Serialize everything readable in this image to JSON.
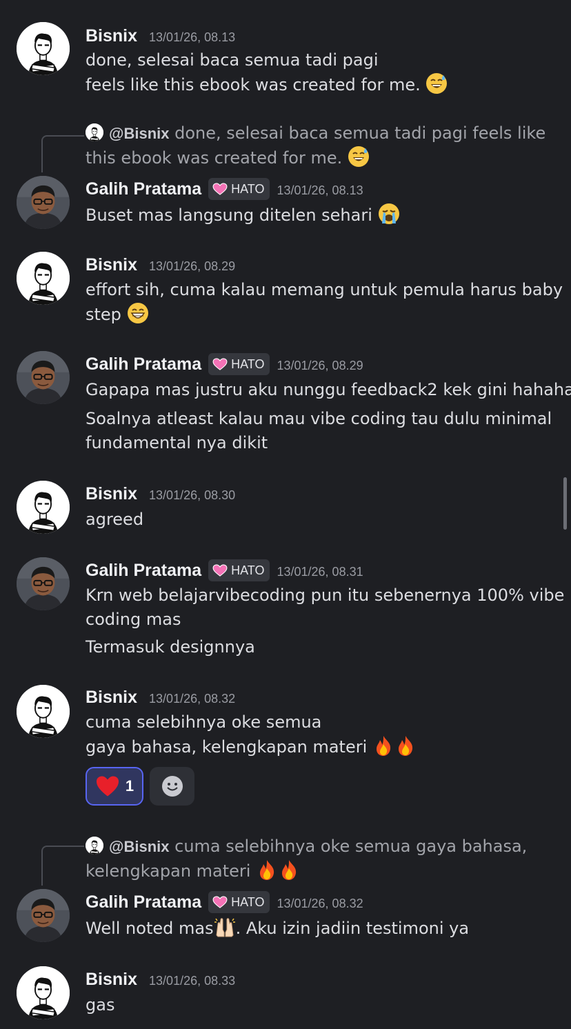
{
  "messages": [
    {
      "author": "Bisnix",
      "time": "13/01/26, 08.13",
      "lines": [
        "done, selesai baca semua tadi pagi",
        "feels like this ebook was created for me."
      ]
    },
    {
      "author": "Galih Pratama",
      "tag": "HATO",
      "time": "13/01/26, 08.13",
      "reply": {
        "mention": "@Bisnix",
        "lines": [
          "done, selesai baca semua tadi pagi feels like",
          "this ebook was created for me."
        ]
      },
      "lines": [
        "Buset mas langsung ditelen sehari"
      ]
    },
    {
      "author": "Bisnix",
      "time": "13/01/26, 08.29",
      "lines": [
        "effort sih, cuma kalau memang untuk pemula harus baby",
        "step"
      ]
    },
    {
      "author": "Galih Pratama",
      "tag": "HATO",
      "time": "13/01/26, 08.29",
      "lines": [
        "Gapapa mas justru aku nunggu feedback2 kek gini hahaha",
        "Soalnya atleast kalau mau vibe coding tau dulu minimal",
        "fundamental nya dikit"
      ]
    },
    {
      "author": "Bisnix",
      "time": "13/01/26, 08.30",
      "lines": [
        "agreed"
      ]
    },
    {
      "author": "Galih Pratama",
      "tag": "HATO",
      "time": "13/01/26, 08.31",
      "lines": [
        "Krn web belajarvibecoding pun itu sebenernya 100% vibe",
        "coding mas",
        "Termasuk designnya"
      ]
    },
    {
      "author": "Bisnix",
      "time": "13/01/26, 08.32",
      "lines": [
        "cuma selebihnya oke semua",
        "gaya bahasa, kelengkapan materi"
      ],
      "reactions": [
        {
          "emoji": "red-heart",
          "count": "1"
        }
      ]
    },
    {
      "author": "Galih Pratama",
      "tag": "HATO",
      "time": "13/01/26, 08.32",
      "reply": {
        "mention": "@Bisnix",
        "lines": [
          "cuma selebihnya oke semua gaya bahasa,",
          "kelengkapan materi"
        ]
      },
      "lines": [
        "Well noted mas",
        ". Aku izin jadiin testimoni ya"
      ]
    },
    {
      "author": "Bisnix",
      "time": "13/01/26, 08.33",
      "lines": [
        "gas"
      ]
    }
  ],
  "icons": {
    "emoji_sweat_smile": "grinning-face-with-sweat-icon",
    "emoji_cry": "loudly-crying-face-icon",
    "emoji_grin": "grinning-face-icon",
    "emoji_fire": "fire-icon",
    "emoji_raised_hands": "raising-hands-icon",
    "add_reaction": "add-reaction-icon"
  },
  "colors": {
    "background": "#1e1f23",
    "reaction_active_border": "#5865f2",
    "tag_bg": "#35373d"
  }
}
